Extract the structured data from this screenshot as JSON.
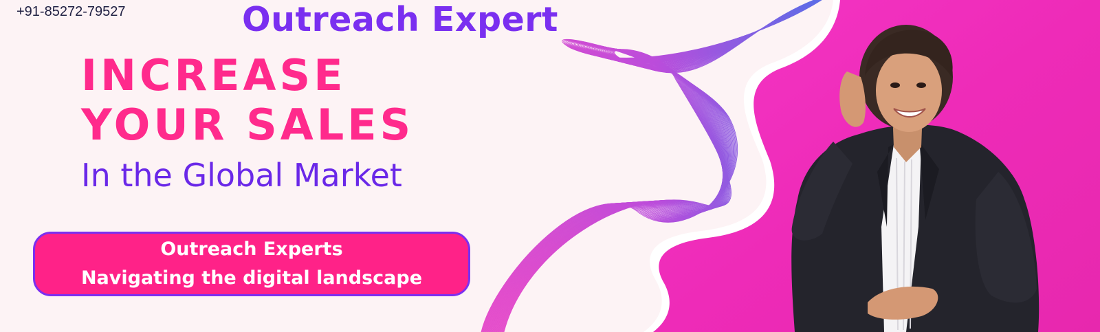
{
  "contact": {
    "phone": "+91-85272-79527"
  },
  "brand": {
    "title": "Outreach Expert"
  },
  "hero": {
    "headline_line1": "INCREASE",
    "headline_line2": "YOUR SALES",
    "subheadline": "In the Global Market"
  },
  "cta": {
    "line1": "Outreach Experts",
    "line2": "Navigating the digital landscape"
  },
  "colors": {
    "background": "#fdf3f5",
    "headline_pink": "#ff2a8c",
    "brand_purple": "#7a2ff0",
    "cta_fill": "#ff2288",
    "cta_border": "#7b2ff0",
    "photo_backdrop": "#f02cbc"
  },
  "images": {
    "wave": "abstract-line-wave-graphic",
    "photo": "smiling-woman-in-black-blazer-photo"
  }
}
